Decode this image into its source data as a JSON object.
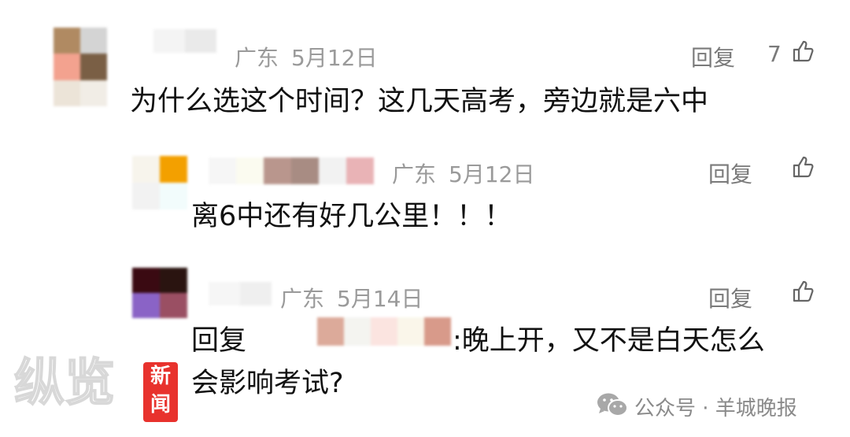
{
  "comments": [
    {
      "location": "广东",
      "date": "5月12日",
      "reply_label": "回复",
      "like_count": "7",
      "content": "为什么选这个时间？这几天高考，旁边就是六中"
    },
    {
      "location": "广东",
      "date": "5月12日",
      "reply_label": "回复",
      "content": "离6中还有好几公里！！！"
    },
    {
      "location": "广东",
      "date": "5月14日",
      "reply_label": "回复",
      "reply_prefix": "回复",
      "content_line1": ":晚上开，又不是白天怎么",
      "content_line2": "会影响考试?"
    }
  ],
  "watermark": {
    "left_text": "纵览",
    "badge_text": [
      "新",
      "闻"
    ],
    "source": "公众号 · 羊城晚报"
  },
  "colors": {
    "meta_gray": "#9a9a9a",
    "action_gray": "#7a7a7a",
    "badge_red": "#e8322d"
  },
  "icons": {
    "like": "thumbs-up-icon",
    "wechat": "wechat-icon"
  }
}
